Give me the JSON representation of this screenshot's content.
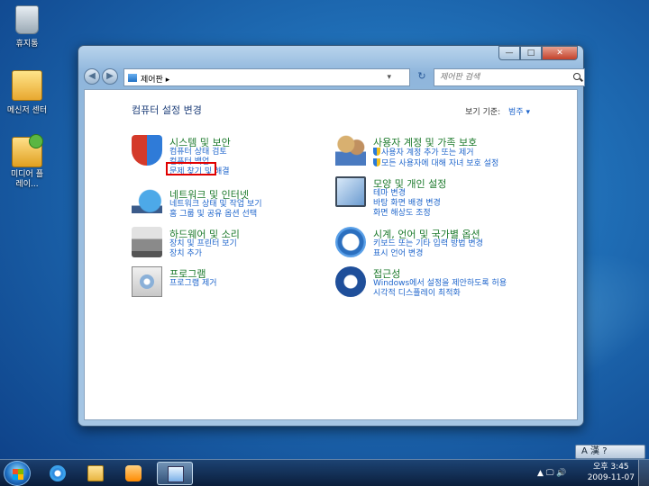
{
  "desktop": {
    "icons": [
      {
        "label": "휴지통",
        "icon": "recycle-bin-icon"
      },
      {
        "label": "메신저 센터",
        "icon": "messenger-icon"
      },
      {
        "label": "미디어 플레이...",
        "icon": "media-player-icon"
      }
    ]
  },
  "window": {
    "address": {
      "breadcrumb": "제어판 ▸",
      "separator": "▸"
    },
    "search": {
      "placeholder": "제어판 검색"
    },
    "content": {
      "title": "컴퓨터 설정 변경",
      "view_by_label": "보기 기준:",
      "view_by_value": "범주 ▾",
      "categories": [
        {
          "title": "시스템 및 보안",
          "icon": "security-shield-icon",
          "links": [
            "컴퓨터 상태 검토",
            "컴퓨터 백업",
            "문제 찾기 및 해결"
          ]
        },
        {
          "title": "네트워크 및 인터넷",
          "icon": "network-globe-icon",
          "links": [
            "네트워크 상태 및 작업 보기",
            "홈 그룹 및 공유 옵션 선택"
          ]
        },
        {
          "title": "하드웨어 및 소리",
          "icon": "printer-icon",
          "links": [
            "장치 및 프린터 보기",
            "장치 추가"
          ]
        },
        {
          "title": "프로그램",
          "icon": "programs-icon",
          "links": [
            "프로그램 제거"
          ]
        },
        {
          "title": "사용자 계정 및 가족 보호",
          "icon": "users-icon",
          "links": [
            "사용자 계정 추가 또는 제거",
            "모든 사용자에 대해 자녀 보호 설정"
          ]
        },
        {
          "title": "모양 및 개인 설정",
          "icon": "appearance-monitor-icon",
          "links": [
            "테마 변경",
            "바탕 화면 배경 변경",
            "화면 해상도 조정"
          ]
        },
        {
          "title": "시계, 언어 및 국가별 옵션",
          "icon": "clock-globe-icon",
          "links": [
            "키보드 또는 기타 입력 방법 변경",
            "표시 언어 변경"
          ]
        },
        {
          "title": "접근성",
          "icon": "ease-of-access-icon",
          "links": [
            "Windows에서 설정을 제안하도록 허용",
            "시각적 디스플레이 최적화"
          ]
        }
      ]
    }
  },
  "highlight": {
    "target": "컴퓨터 백업",
    "color": "#e00000"
  },
  "language_bar": {
    "label": "A 漢 ?"
  },
  "taskbar": {
    "items": [
      "internet-explorer-icon",
      "folder-icon",
      "media-player-icon",
      "control-panel-icon"
    ],
    "tray": "▲ 🖵 🔊",
    "time": "오후 3:45",
    "date": "2009-11-07"
  }
}
